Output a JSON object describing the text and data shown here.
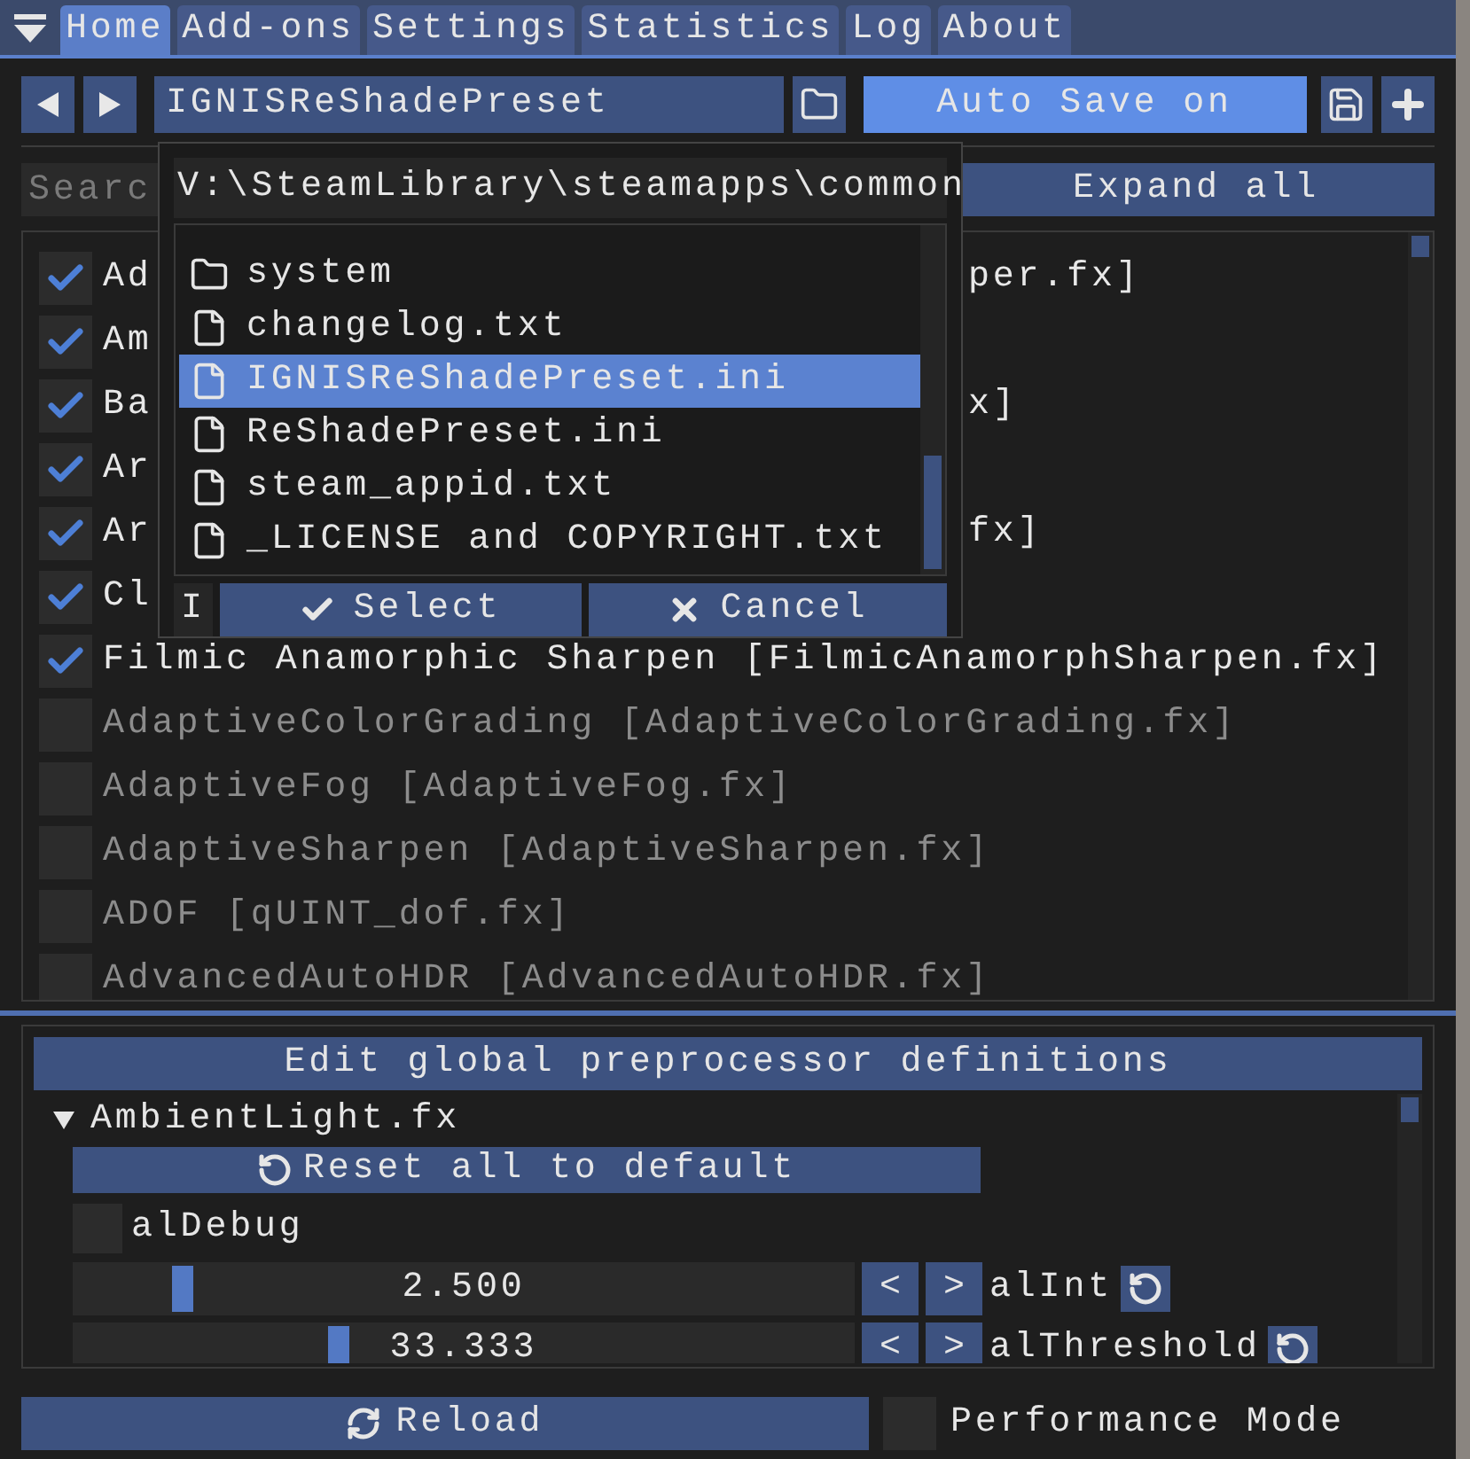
{
  "tabs": [
    {
      "label": "Home",
      "selected": true
    },
    {
      "label": "Add-ons",
      "selected": false
    },
    {
      "label": "Settings",
      "selected": false
    },
    {
      "label": "Statistics",
      "selected": false
    },
    {
      "label": "Log",
      "selected": false
    },
    {
      "label": "About",
      "selected": false
    }
  ],
  "preset": {
    "name": "IGNISReShadePreset",
    "auto_save": "Auto Save on"
  },
  "search": {
    "placeholder": "Searc"
  },
  "expand_button": "Expand all",
  "effects": [
    {
      "lead": "Ad",
      "tail": "per.fx]",
      "checked": true
    },
    {
      "lead": "Am",
      "checked": true
    },
    {
      "lead": "Ba",
      "tail": "x]",
      "checked": true
    },
    {
      "lead": "Ar",
      "checked": true
    },
    {
      "lead": "Ar",
      "tail": "fx]",
      "checked": true
    },
    {
      "lead": "Cl",
      "checked": true
    },
    {
      "lead": "Filmic Anamorphic Sharpen [FilmicAnamorphSharpen.fx]",
      "checked": true
    },
    {
      "lead": "AdaptiveColorGrading [AdaptiveColorGrading.fx]",
      "checked": false
    },
    {
      "lead": "AdaptiveFog [AdaptiveFog.fx]",
      "checked": false
    },
    {
      "lead": "AdaptiveSharpen [AdaptiveSharpen.fx]",
      "checked": false
    },
    {
      "lead": "ADOF [qUINT_dof.fx]",
      "checked": false
    },
    {
      "lead": "AdvancedAutoHDR [AdvancedAutoHDR.fx]",
      "checked": false
    }
  ],
  "file_browser": {
    "path": "V:\\SteamLibrary\\steamapps\\common",
    "entries": [
      {
        "kind": "folder",
        "name": "system",
        "selected": false
      },
      {
        "kind": "file",
        "name": "changelog.txt",
        "selected": false
      },
      {
        "kind": "file",
        "name": "IGNISReShadePreset.ini",
        "selected": true
      },
      {
        "kind": "file",
        "name": "ReShadePreset.ini",
        "selected": false
      },
      {
        "kind": "file",
        "name": "steam_appid.txt",
        "selected": false
      },
      {
        "kind": "file",
        "name": "_LICENSE and COPYRIGHT.txt",
        "selected": false
      }
    ],
    "filename": "I",
    "select": "Select",
    "cancel": "Cancel"
  },
  "preprocessor": {
    "button": "Edit global preprocessor definitions",
    "file": "AmbientLight.fx",
    "expanded": true,
    "reset": "Reset all to default",
    "options": [
      {
        "kind": "checkbox",
        "name": "alDebug",
        "checked": false
      },
      {
        "kind": "slider",
        "name": "alInt",
        "value": "2.500",
        "level": 0.14,
        "decrement": "<",
        "increment": ">"
      },
      {
        "kind": "slider",
        "name": "alThreshold",
        "value": "33.333",
        "level": 0.34,
        "decrement": "<",
        "increment": ">"
      }
    ]
  },
  "footer": {
    "reload": "Reload",
    "performance_mode": {
      "label": "Performance Mode",
      "checked": false
    }
  }
}
